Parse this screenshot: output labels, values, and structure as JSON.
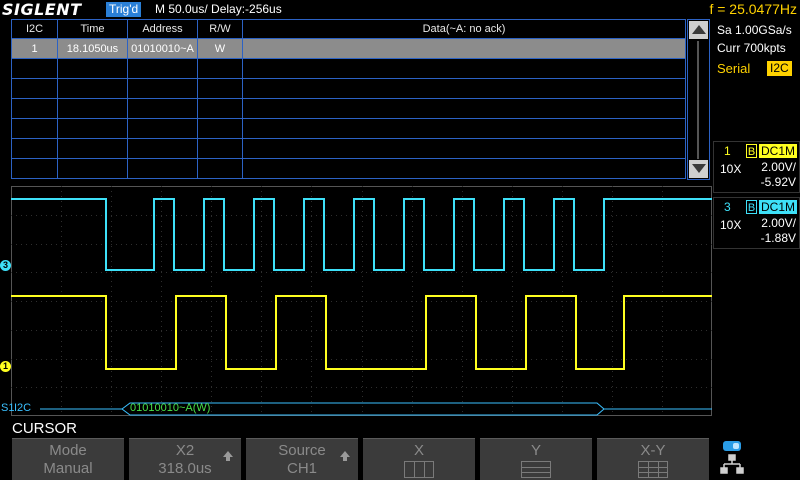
{
  "topbar": {
    "logo": "SIGLENT",
    "trigger_status": "Trig'd",
    "timebase": "M 50.0us/  Delay:-256us",
    "frequency": "f = 25.0477Hz"
  },
  "table": {
    "headers": [
      "I2C",
      "Time",
      "Address",
      "R/W",
      "Data(~A: no ack)"
    ],
    "rows": [
      {
        "index": "1",
        "time": "18.1050us",
        "address": "01010010~A",
        "rw": "W",
        "data": ""
      }
    ]
  },
  "right_panel": {
    "sample_rate": "Sa 1.00GSa/s",
    "memory_depth": "Curr 700kpts",
    "serial_label": "Serial",
    "serial_protocol": "I2C",
    "channels": [
      {
        "num": "1",
        "bw": "B",
        "coupling": "DC1M",
        "probe": "10X",
        "volts_div": "2.00V/",
        "offset": "-5.92V",
        "color": "#ffff20"
      },
      {
        "num": "3",
        "bw": "B",
        "coupling": "DC1M",
        "probe": "10X",
        "volts_div": "2.00V/",
        "offset": "-1.88V",
        "color": "#3ee0f8"
      }
    ]
  },
  "waveform": {
    "ch3_marker": "3",
    "ch1_marker": "1",
    "ch3_color": "#3ee0f8",
    "ch1_color": "#ffff20"
  },
  "bus": {
    "marker": "S1",
    "name": "I2C",
    "decoded": "01010010~A(W)"
  },
  "menu": {
    "title": "CURSOR",
    "buttons": [
      {
        "line1": "Mode",
        "line2": "Manual"
      },
      {
        "line1": "X2",
        "line2": "318.0us"
      },
      {
        "line1": "Source",
        "line2": "CH1"
      },
      {
        "line1": "X",
        "line2": ""
      },
      {
        "line1": "Y",
        "line2": ""
      },
      {
        "line1": "X-Y",
        "line2": ""
      }
    ]
  },
  "icons": {
    "trigger_pointer": "trigger-position-icon",
    "usb": "usb-device-icon",
    "network": "network-icon"
  }
}
